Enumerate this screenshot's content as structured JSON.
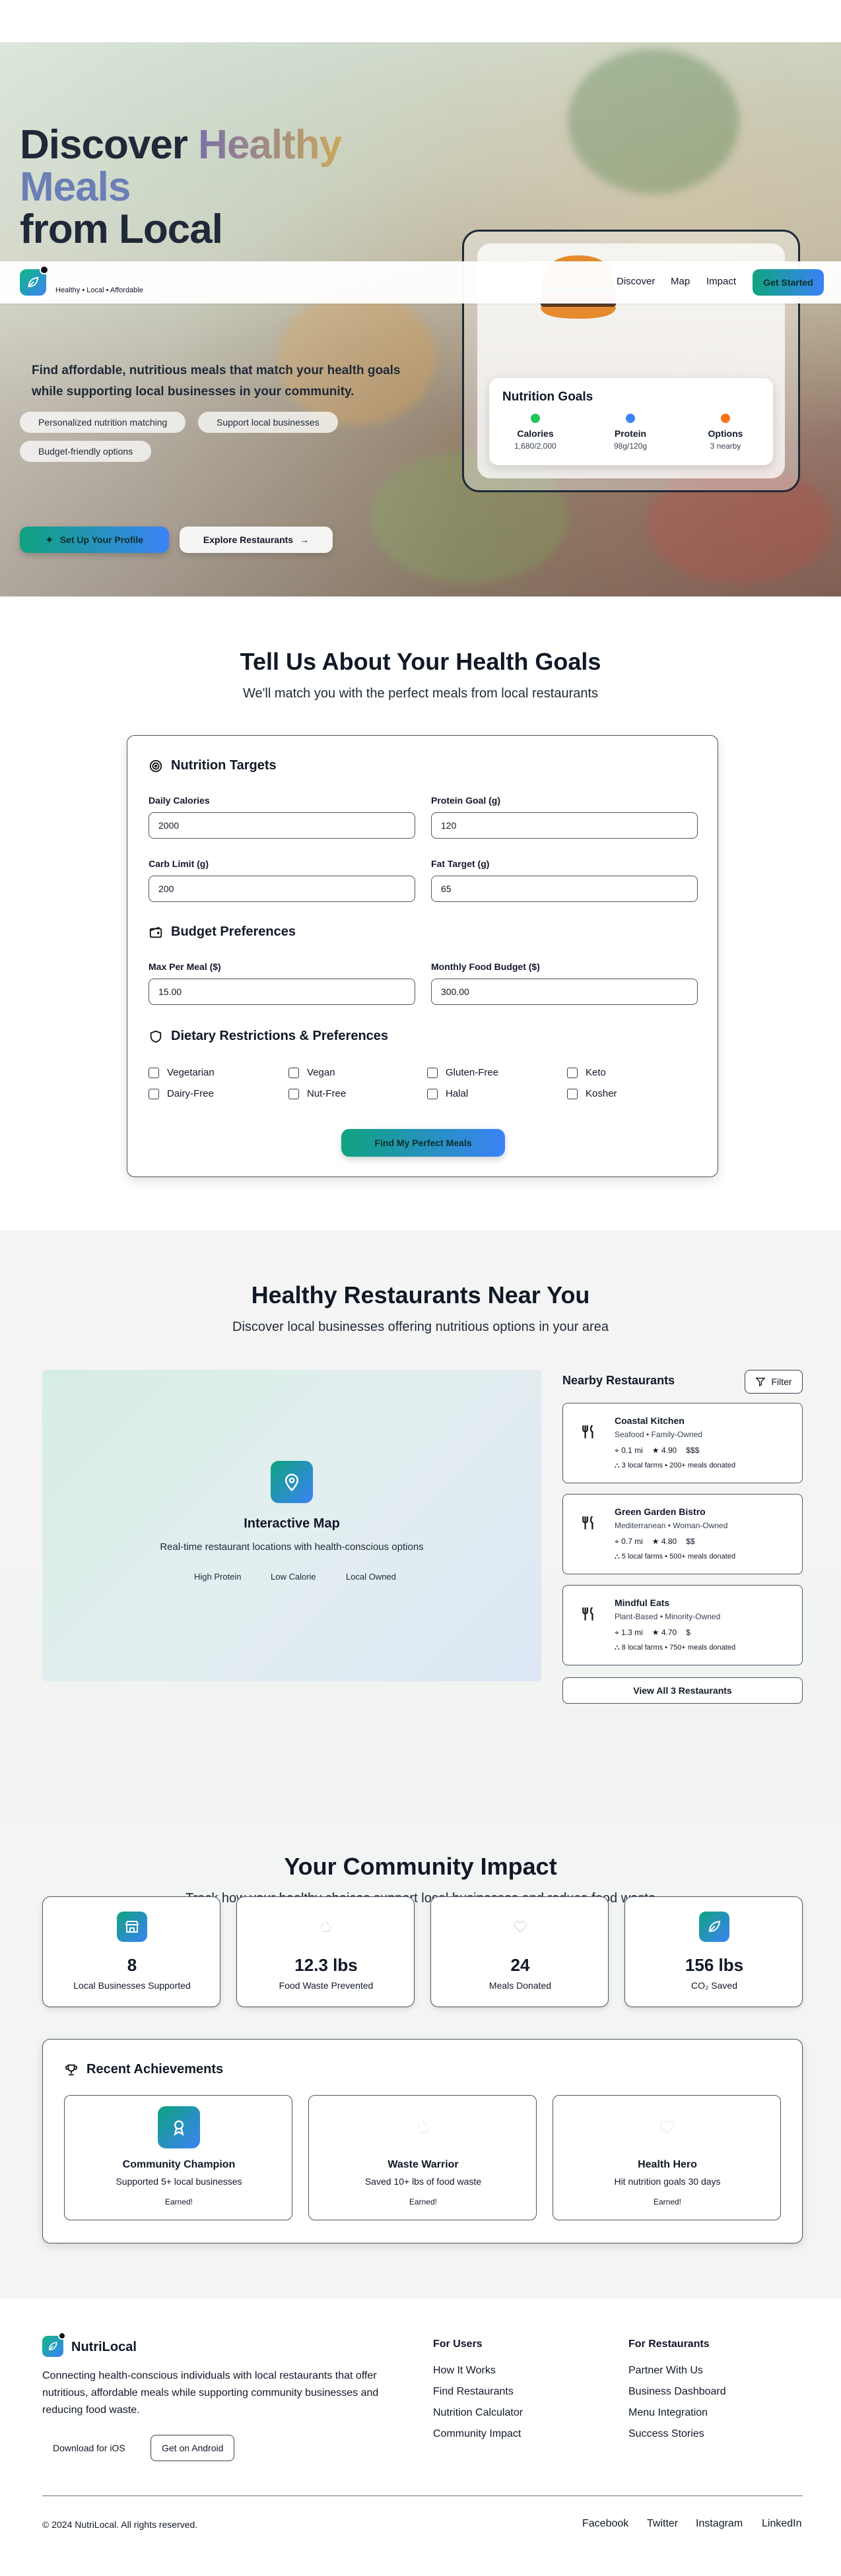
{
  "hero": {
    "title_line1": "Discover",
    "title_line1_accent": "Healthy",
    "title_line2": "Meals",
    "title_line3": "from Local",
    "description": "Find affordable, nutritious meals that match your health goals while supporting local businesses in your community.",
    "chips": [
      "Personalized nutrition matching",
      "Support local businesses",
      "Budget-friendly options"
    ],
    "primary_button": "Set Up Your Profile",
    "secondary_button": "Explore Restaurants",
    "card": {
      "title": "Nutrition Goals",
      "goals": [
        {
          "label": "Calories",
          "value": "1,680/2,000",
          "color": "#22c55e"
        },
        {
          "label": "Protein",
          "value": "98g/120g",
          "color": "#3b82f6"
        },
        {
          "label": "Options",
          "value": "3 nearby",
          "color": "#f97316"
        }
      ]
    }
  },
  "navbar": {
    "tagline": "Healthy • Local • Affordable",
    "links": [
      "Discover",
      "Map",
      "Impact"
    ],
    "cta": "Get Started"
  },
  "goals_form": {
    "title": "Tell Us About Your Health Goals",
    "subtitle": "We'll match you with the perfect meals from local restaurants",
    "nutrition": {
      "heading": "Nutrition Targets",
      "daily_calories_label": "Daily Calories",
      "daily_calories_value": "2000",
      "protein_label": "Protein Goal (g)",
      "protein_value": "120",
      "carb_label": "Carb Limit (g)",
      "carb_value": "200",
      "fat_label": "Fat Target (g)",
      "fat_value": "65"
    },
    "budget": {
      "heading": "Budget Preferences",
      "max_meal_label": "Max Per Meal ($)",
      "max_meal_value": "15.00",
      "monthly_label": "Monthly Food Budget ($)",
      "monthly_value": "300.00"
    },
    "dietary": {
      "heading": "Dietary Restrictions & Preferences",
      "options": [
        "Vegetarian",
        "Vegan",
        "Gluten-Free",
        "Keto",
        "Dairy-Free",
        "Nut-Free",
        "Halal",
        "Kosher"
      ]
    },
    "submit": "Find My Perfect Meals"
  },
  "restaurants": {
    "title": "Healthy Restaurants Near You",
    "subtitle": "Discover local businesses offering nutritious options in your area",
    "map": {
      "title": "Interactive Map",
      "subtitle": "Real-time restaurant locations with health-conscious options",
      "tags": [
        "High Protein",
        "Low Calorie",
        "Local Owned"
      ]
    },
    "nearby_heading": "Nearby Restaurants",
    "filter_label": "Filter",
    "list": [
      {
        "name": "Coastal Kitchen",
        "type": "Seafood • Family-Owned",
        "distance": "0.1 mi",
        "rating": "4.90",
        "price": "$$$",
        "impact": "3 local farms  • 200+ meals donated"
      },
      {
        "name": "Green Garden Bistro",
        "type": "Mediterranean • Woman-Owned",
        "distance": "0.7 mi",
        "rating": "4.80",
        "price": "$$",
        "impact": "5 local farms  • 500+ meals donated"
      },
      {
        "name": "Mindful Eats",
        "type": "Plant-Based • Minority-Owned",
        "distance": "1.3 mi",
        "rating": "4.70",
        "price": "$",
        "impact": "8 local farms  • 750+ meals donated"
      }
    ],
    "view_all": "View All 3 Restaurants"
  },
  "impact": {
    "title": "Your Community Impact",
    "subtitle": "Track how your healthy choices support local businesses and reduce food waste",
    "stats": [
      {
        "value": "8",
        "label": "Local Businesses Supported"
      },
      {
        "value": "12.3 lbs",
        "label": "Food Waste Prevented"
      },
      {
        "value": "24",
        "label": "Meals Donated"
      },
      {
        "value": "156 lbs",
        "label": "CO₂ Saved"
      }
    ],
    "achievements_heading": "Recent Achievements",
    "achievements": [
      {
        "title": "Community Champion",
        "desc": "Supported 5+ local businesses",
        "status": "Earned!"
      },
      {
        "title": "Waste Warrior",
        "desc": "Saved 10+ lbs of food waste",
        "status": "Earned!"
      },
      {
        "title": "Health Hero",
        "desc": "Hit nutrition goals 30 days",
        "status": "Earned!"
      }
    ]
  },
  "footer": {
    "brand": "NutriLocal",
    "description": "Connecting health-conscious individuals with local restaurants that offer nutritious, affordable meals while supporting community businesses and reducing food waste.",
    "ios_button": "Download for iOS",
    "android_button": "Get on Android",
    "users_heading": "For Users",
    "users_links": [
      "How It Works",
      "Find Restaurants",
      "Nutrition Calculator",
      "Community Impact"
    ],
    "restaurants_heading": "For Restaurants",
    "restaurants_links": [
      "Partner With Us",
      "Business Dashboard",
      "Menu Integration",
      "Success Stories"
    ],
    "copyright": "© 2024 NutriLocal. All rights reserved.",
    "social": [
      "Facebook",
      "Twitter",
      "Instagram",
      "LinkedIn"
    ]
  }
}
